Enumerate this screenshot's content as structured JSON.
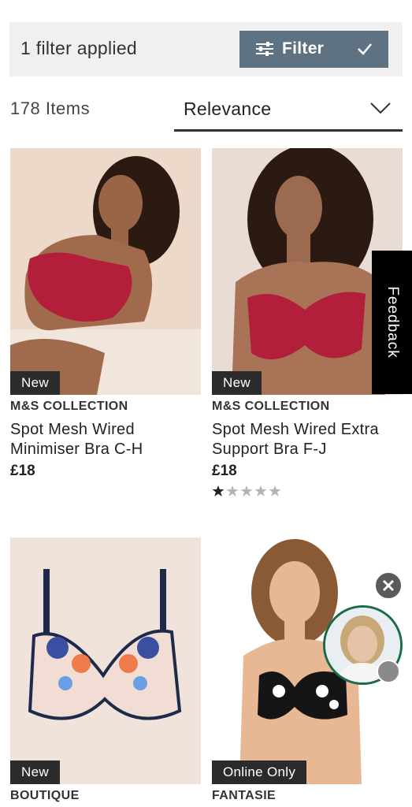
{
  "filter_bar": {
    "applied_text": "1 filter applied",
    "button_label": "Filter"
  },
  "listing": {
    "items_count": "178 Items",
    "sort_value": "Relevance"
  },
  "products": [
    {
      "badge": "New",
      "brand": "M&S COLLECTION",
      "title_line1": "Spot Mesh Wired",
      "title_line2": "Minimiser Bra C-H",
      "price": "£18"
    },
    {
      "badge": "New",
      "brand": "M&S COLLECTION",
      "title_line1": "Spot Mesh Wired Extra",
      "title_line2": "Support Bra F-J",
      "price": "£18",
      "rating": 1,
      "rating_max": 5
    },
    {
      "badge": "New",
      "brand": "BOUTIQUE"
    },
    {
      "badge": "Online Only",
      "brand": "FANTASIE"
    }
  ],
  "feedback": {
    "label": "Feedback"
  },
  "colors": {
    "filter_button": "#5f7282",
    "badge_bg": "#2b2b2b",
    "chat_ring": "#1c6b48",
    "feedback_bg": "#000000"
  },
  "icons": [
    "sliders-icon",
    "check-icon",
    "chevron-down-icon",
    "star-icon",
    "close-icon"
  ]
}
